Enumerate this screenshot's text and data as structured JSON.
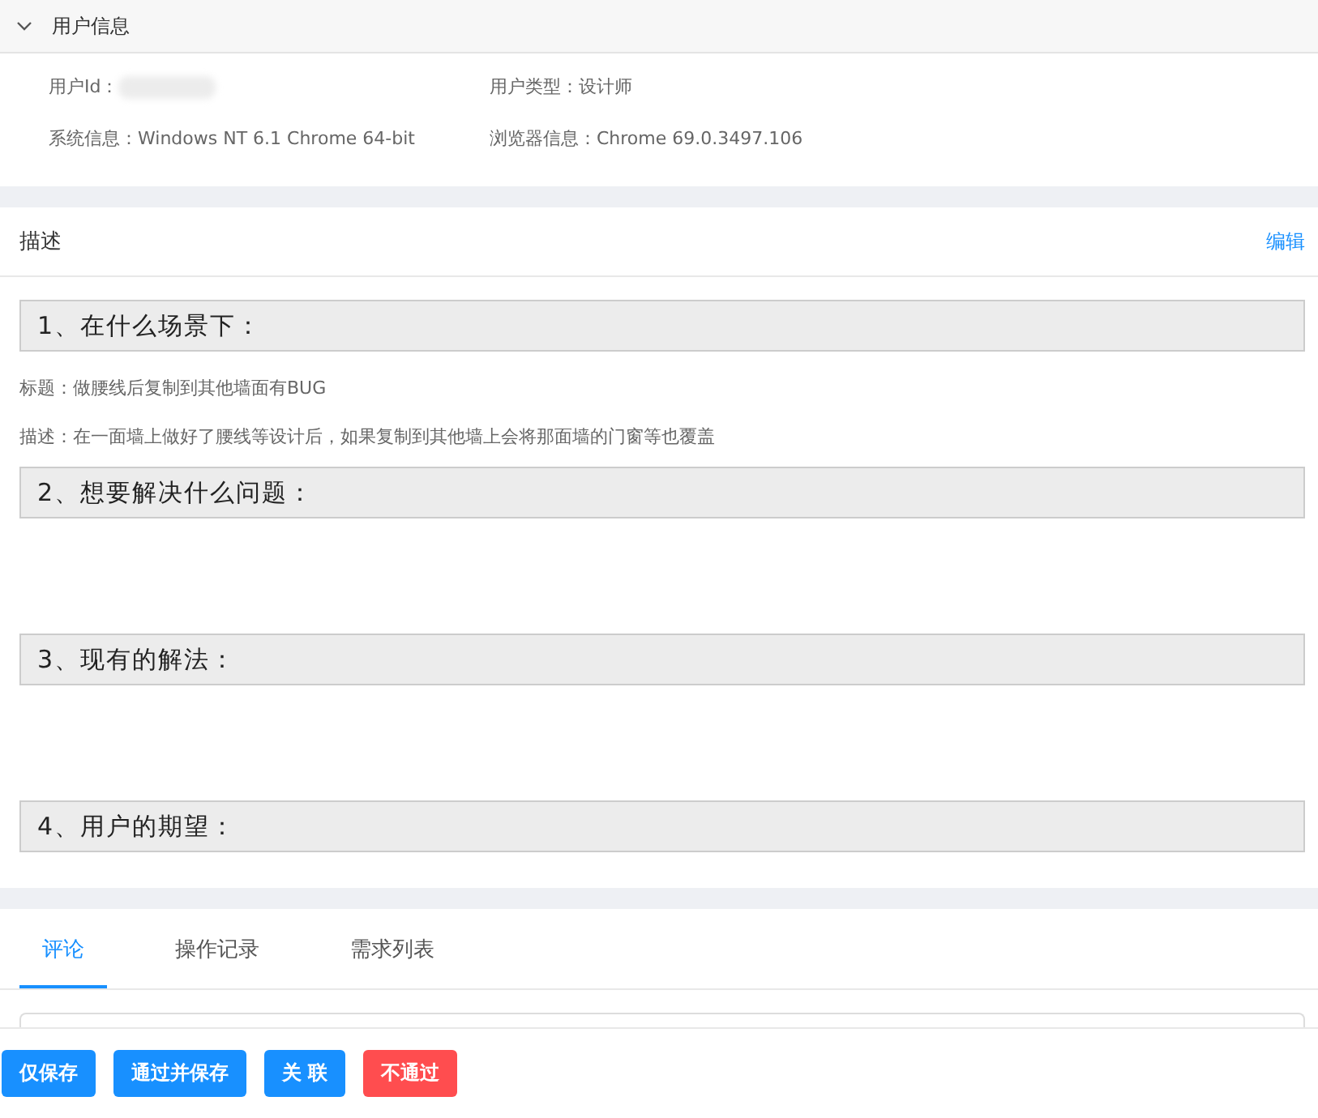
{
  "user_panel": {
    "title": "用户信息",
    "expanded": true,
    "fields": [
      {
        "label": "用户Id："
      },
      {
        "label": "用户类型：",
        "value": "设计师"
      },
      {
        "label": "系统信息：",
        "value": "Windows NT 6.1 Chrome 64-bit"
      },
      {
        "label": "浏览器信息：",
        "value": "Chrome 69.0.3497.106"
      }
    ]
  },
  "description": {
    "title": "描述",
    "edit_link": "编辑",
    "sections": [
      {
        "heading": "1、在什么场景下：",
        "lines": [
          "标题：做腰线后复制到其他墙面有BUG",
          "描述：在一面墙上做好了腰线等设计后，如果复制到其他墙上会将那面墙的门窗等也覆盖"
        ]
      },
      {
        "heading": "2、想要解决什么问题："
      },
      {
        "heading": "3、现有的解法："
      },
      {
        "heading": "4、用户的期望："
      }
    ]
  },
  "tabs": [
    {
      "label": "评论",
      "selected": true
    },
    {
      "label": "操作记录",
      "selected": false
    },
    {
      "label": "需求列表",
      "selected": false
    }
  ],
  "buttons": [
    {
      "label": "仅保存",
      "kind": "primary"
    },
    {
      "label": "通过并保存",
      "kind": "primary"
    },
    {
      "label": "关 联",
      "kind": "primary"
    },
    {
      "label": "不通过",
      "kind": "danger"
    }
  ]
}
